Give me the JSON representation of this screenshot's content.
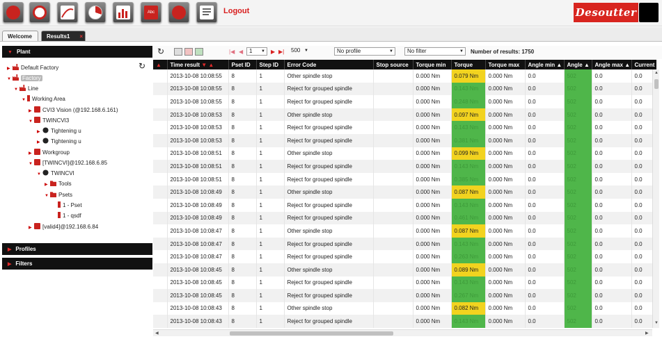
{
  "toolbar": {
    "logout_label": "Logout",
    "brand_label": "Desoutter",
    "buttons": [
      "mode-basic-icon",
      "gauge-icon",
      "curve-icon",
      "pie-chart-icon",
      "bar-chart-icon",
      "abc-icon",
      "clock-icon",
      "calendar-icon",
      "report-icon"
    ]
  },
  "tabs": {
    "welcome": "Welcome",
    "results": "Results1",
    "close": "×"
  },
  "left": {
    "plant_label": "Plant",
    "profiles_label": "Profiles",
    "filters_label": "Filters",
    "tree": [
      "Default Factory",
      "Factory",
      "Line",
      "Working Area",
      "CVI3 Vision (@192.168.6.161)",
      "TWINCVI3",
      "Tightening u",
      "Tightening u",
      "Workgroup",
      "[TWINCVI]@192.168.6.85",
      "TWINCVI",
      "Tools",
      "Psets",
      "1 - Pset",
      "1 - qsdf",
      "[valid4]@192.168.6.84"
    ]
  },
  "gridbar": {
    "page": "1",
    "page_size": "500",
    "profile": "No profile",
    "filter": "No filter",
    "count_label": "Number of results: 1750"
  },
  "columns": [
    "Time result",
    "Pset ID",
    "Step ID",
    "Error Code",
    "Stop source",
    "Torque min",
    "Torque",
    "Torque max",
    "Angle min",
    "Angle",
    "Angle max",
    "Current"
  ],
  "rows": [
    {
      "time": "2013-10-08 10:08:55",
      "pset": "8",
      "step": "1",
      "error": "Other spindle stop",
      "stop": "",
      "tmin": "0.000 Nm",
      "torque": "0.079 Nm",
      "tmax": "0.000 Nm",
      "amin": "0.0",
      "angle": "502",
      "amax": "0.0",
      "current": "0.0",
      "tstate": "y"
    },
    {
      "time": "2013-10-08 10:08:55",
      "pset": "8",
      "step": "1",
      "error": "Reject for grouped spindle",
      "stop": "",
      "tmin": "0.000 Nm",
      "torque": "0.143 Nm",
      "tmax": "0.000 Nm",
      "amin": "0.0",
      "angle": "502",
      "amax": "0.0",
      "current": "0.0",
      "tstate": "g"
    },
    {
      "time": "2013-10-08 10:08:55",
      "pset": "8",
      "step": "1",
      "error": "Reject for grouped spindle",
      "stop": "",
      "tmin": "0.000 Nm",
      "torque": "0.248 Nm",
      "tmax": "0.000 Nm",
      "amin": "0.0",
      "angle": "502",
      "amax": "0.0",
      "current": "0.0",
      "tstate": "g"
    },
    {
      "time": "2013-10-08 10:08:53",
      "pset": "8",
      "step": "1",
      "error": "Other spindle stop",
      "stop": "",
      "tmin": "0.000 Nm",
      "torque": "0.097 Nm",
      "tmax": "0.000 Nm",
      "amin": "0.0",
      "angle": "502",
      "amax": "0.0",
      "current": "0.0",
      "tstate": "y"
    },
    {
      "time": "2013-10-08 10:08:53",
      "pset": "8",
      "step": "1",
      "error": "Reject for grouped spindle",
      "stop": "",
      "tmin": "0.000 Nm",
      "torque": "0.143 Nm",
      "tmax": "0.000 Nm",
      "amin": "0.0",
      "angle": "502",
      "amax": "0.0",
      "current": "0.0",
      "tstate": "g"
    },
    {
      "time": "2013-10-08 10:08:53",
      "pset": "8",
      "step": "1",
      "error": "Reject for grouped spindle",
      "stop": "",
      "tmin": "0.000 Nm",
      "torque": "0.381 Nm",
      "tmax": "0.000 Nm",
      "amin": "0.0",
      "angle": "502",
      "amax": "0.0",
      "current": "0.0",
      "tstate": "g"
    },
    {
      "time": "2013-10-08 10:08:51",
      "pset": "8",
      "step": "1",
      "error": "Other spindle stop",
      "stop": "",
      "tmin": "0.000 Nm",
      "torque": "0.099 Nm",
      "tmax": "0.000 Nm",
      "amin": "0.0",
      "angle": "502",
      "amax": "0.0",
      "current": "0.0",
      "tstate": "y"
    },
    {
      "time": "2013-10-08 10:08:51",
      "pset": "8",
      "step": "1",
      "error": "Reject for grouped spindle",
      "stop": "",
      "tmin": "0.000 Nm",
      "torque": "0.143 Nm",
      "tmax": "0.000 Nm",
      "amin": "0.0",
      "angle": "502",
      "amax": "0.0",
      "current": "0.0",
      "tstate": "g"
    },
    {
      "time": "2013-10-08 10:08:51",
      "pset": "8",
      "step": "1",
      "error": "Reject for grouped spindle",
      "stop": "",
      "tmin": "0.000 Nm",
      "torque": "0.385 Nm",
      "tmax": "0.000 Nm",
      "amin": "0.0",
      "angle": "502",
      "amax": "0.0",
      "current": "0.0",
      "tstate": "g"
    },
    {
      "time": "2013-10-08 10:08:49",
      "pset": "8",
      "step": "1",
      "error": "Other spindle stop",
      "stop": "",
      "tmin": "0.000 Nm",
      "torque": "0.087 Nm",
      "tmax": "0.000 Nm",
      "amin": "0.0",
      "angle": "502",
      "amax": "0.0",
      "current": "0.0",
      "tstate": "y"
    },
    {
      "time": "2013-10-08 10:08:49",
      "pset": "8",
      "step": "1",
      "error": "Reject for grouped spindle",
      "stop": "",
      "tmin": "0.000 Nm",
      "torque": "0.143 Nm",
      "tmax": "0.000 Nm",
      "amin": "0.0",
      "angle": "502",
      "amax": "0.0",
      "current": "0.0",
      "tstate": "g"
    },
    {
      "time": "2013-10-08 10:08:49",
      "pset": "8",
      "step": "1",
      "error": "Reject for grouped spindle",
      "stop": "",
      "tmin": "0.000 Nm",
      "torque": "0.461 Nm",
      "tmax": "0.000 Nm",
      "amin": "0.0",
      "angle": "502",
      "amax": "0.0",
      "current": "0.0",
      "tstate": "g"
    },
    {
      "time": "2013-10-08 10:08:47",
      "pset": "8",
      "step": "1",
      "error": "Other spindle stop",
      "stop": "",
      "tmin": "0.000 Nm",
      "torque": "0.087 Nm",
      "tmax": "0.000 Nm",
      "amin": "0.0",
      "angle": "502",
      "amax": "0.0",
      "current": "0.0",
      "tstate": "y"
    },
    {
      "time": "2013-10-08 10:08:47",
      "pset": "8",
      "step": "1",
      "error": "Reject for grouped spindle",
      "stop": "",
      "tmin": "0.000 Nm",
      "torque": "0.143 Nm",
      "tmax": "0.000 Nm",
      "amin": "0.0",
      "angle": "502",
      "amax": "0.0",
      "current": "0.0",
      "tstate": "g"
    },
    {
      "time": "2013-10-08 10:08:47",
      "pset": "8",
      "step": "1",
      "error": "Reject for grouped spindle",
      "stop": "",
      "tmin": "0.000 Nm",
      "torque": "0.263 Nm",
      "tmax": "0.000 Nm",
      "amin": "0.0",
      "angle": "502",
      "amax": "0.0",
      "current": "0.0",
      "tstate": "g"
    },
    {
      "time": "2013-10-08 10:08:45",
      "pset": "8",
      "step": "1",
      "error": "Other spindle stop",
      "stop": "",
      "tmin": "0.000 Nm",
      "torque": "0.089 Nm",
      "tmax": "0.000 Nm",
      "amin": "0.0",
      "angle": "502",
      "amax": "0.0",
      "current": "0.0",
      "tstate": "y"
    },
    {
      "time": "2013-10-08 10:08:45",
      "pset": "8",
      "step": "1",
      "error": "Reject for grouped spindle",
      "stop": "",
      "tmin": "0.000 Nm",
      "torque": "0.143 Nm",
      "tmax": "0.000 Nm",
      "amin": "0.0",
      "angle": "502",
      "amax": "0.0",
      "current": "0.0",
      "tstate": "g"
    },
    {
      "time": "2013-10-08 10:08:45",
      "pset": "8",
      "step": "1",
      "error": "Reject for grouped spindle",
      "stop": "",
      "tmin": "0.000 Nm",
      "torque": "0.267 Nm",
      "tmax": "0.000 Nm",
      "amin": "0.0",
      "angle": "502",
      "amax": "0.0",
      "current": "0.0",
      "tstate": "g"
    },
    {
      "time": "2013-10-08 10:08:43",
      "pset": "8",
      "step": "1",
      "error": "Other spindle stop",
      "stop": "",
      "tmin": "0.000 Nm",
      "torque": "0.082 Nm",
      "tmax": "0.000 Nm",
      "amin": "0.0",
      "angle": "502",
      "amax": "0.0",
      "current": "0.0",
      "tstate": "y"
    },
    {
      "time": "2013-10-08 10:08:43",
      "pset": "8",
      "step": "1",
      "error": "Reject for grouped spindle",
      "stop": "",
      "tmin": "0.000 Nm",
      "torque": "0.143 Nm",
      "tmax": "0.000 Nm",
      "amin": "0.0",
      "angle": "502",
      "amax": "0.0",
      "current": "0.0",
      "tstate": "g"
    }
  ],
  "colors": {
    "ok": "#4fb64a",
    "warn": "#f2d31f",
    "accent": "#d81c1c"
  }
}
